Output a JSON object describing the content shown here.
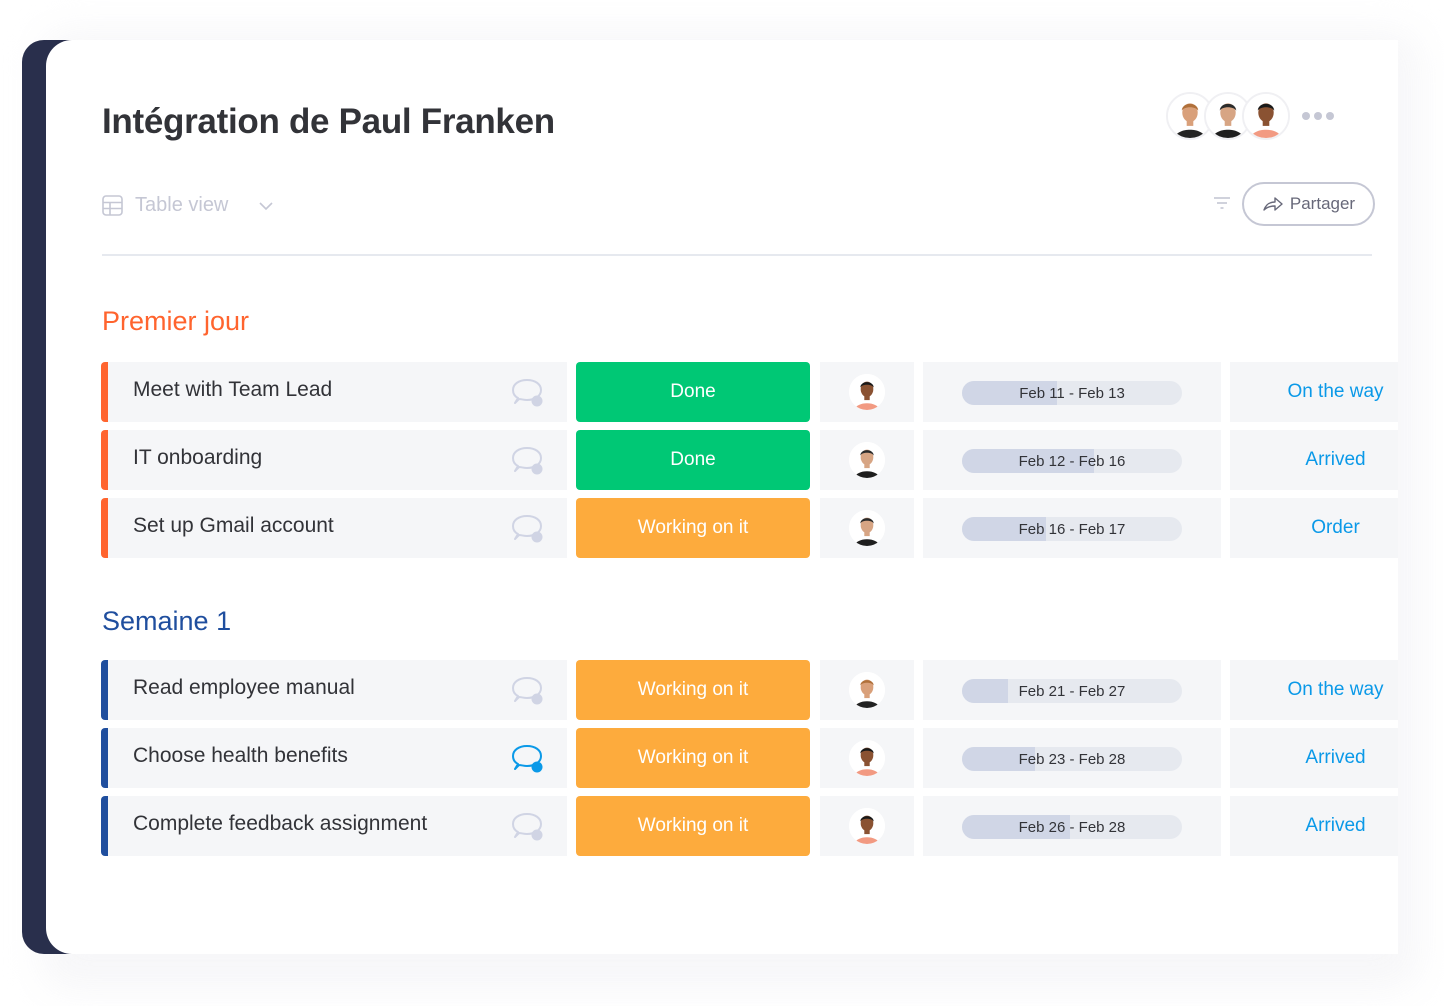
{
  "board": {
    "title": "Intégration de Paul Franken",
    "view_label": "Table view",
    "share_label": "Partager",
    "icons": {
      "view": "table-icon",
      "view_dropdown": "chevron-down-icon",
      "filter": "filter-icon",
      "share": "share-arrow-icon",
      "more": "more-dots-icon"
    },
    "members": [
      {
        "name": "woman-avatar",
        "skin": "#d9a07a",
        "hair": "#b0703a",
        "shirt": "#222222",
        "accent": "#f5a623"
      },
      {
        "name": "bearded-man-avatar",
        "skin": "#d7a584",
        "hair": "#2b2b2b",
        "shirt": "#1e1e1e",
        "accent": "#d0e0f0"
      },
      {
        "name": "smiling-man-avatar",
        "skin": "#8a5232",
        "hair": "#1a1a1a",
        "shirt": "#f29a82",
        "accent": "#f29a82"
      }
    ]
  },
  "colors": {
    "group1": "#ff642e",
    "group2": "#1f4e9e",
    "done": "#00c875",
    "working": "#fdab3d",
    "delivery_text": "#0a99e8",
    "chat_inactive": "#d0d4e4",
    "chat_active": "#0a99e8"
  },
  "groups": [
    {
      "title": "Premier jour",
      "color": "#ff642e",
      "rows": [
        {
          "name": "Meet with Team Lead",
          "chat_active": false,
          "status": "Done",
          "status_color": "#00c875",
          "owner": 2,
          "timeline": "Feb 11 - Feb 13",
          "timeline_progress": 0.43,
          "delivery": "On the way"
        },
        {
          "name": "IT onboarding",
          "chat_active": false,
          "status": "Done",
          "status_color": "#00c875",
          "owner": 1,
          "timeline": "Feb 12 - Feb 16",
          "timeline_progress": 0.6,
          "delivery": "Arrived"
        },
        {
          "name": "Set up Gmail account",
          "chat_active": false,
          "status": "Working on it",
          "status_color": "#fdab3d",
          "owner": 1,
          "timeline": "Feb 16 - Feb 17",
          "timeline_progress": 0.38,
          "delivery": "Order"
        }
      ]
    },
    {
      "title": "Semaine 1",
      "color": "#1f4e9e",
      "rows": [
        {
          "name": "Read employee manual",
          "chat_active": false,
          "status": "Working on it",
          "status_color": "#fdab3d",
          "owner": 0,
          "timeline": "Feb 21 - Feb 27",
          "timeline_progress": 0.21,
          "delivery": "On the way"
        },
        {
          "name": "Choose health benefits",
          "chat_active": true,
          "status": "Working on it",
          "status_color": "#fdab3d",
          "owner": 2,
          "timeline": "Feb 23 - Feb 28",
          "timeline_progress": 0.33,
          "delivery": "Arrived"
        },
        {
          "name": "Complete feedback assignment",
          "chat_active": false,
          "status": "Working on it",
          "status_color": "#fdab3d",
          "owner": 2,
          "timeline": "Feb 26 - Feb 28",
          "timeline_progress": 0.49,
          "delivery": "Arrived"
        }
      ]
    }
  ]
}
